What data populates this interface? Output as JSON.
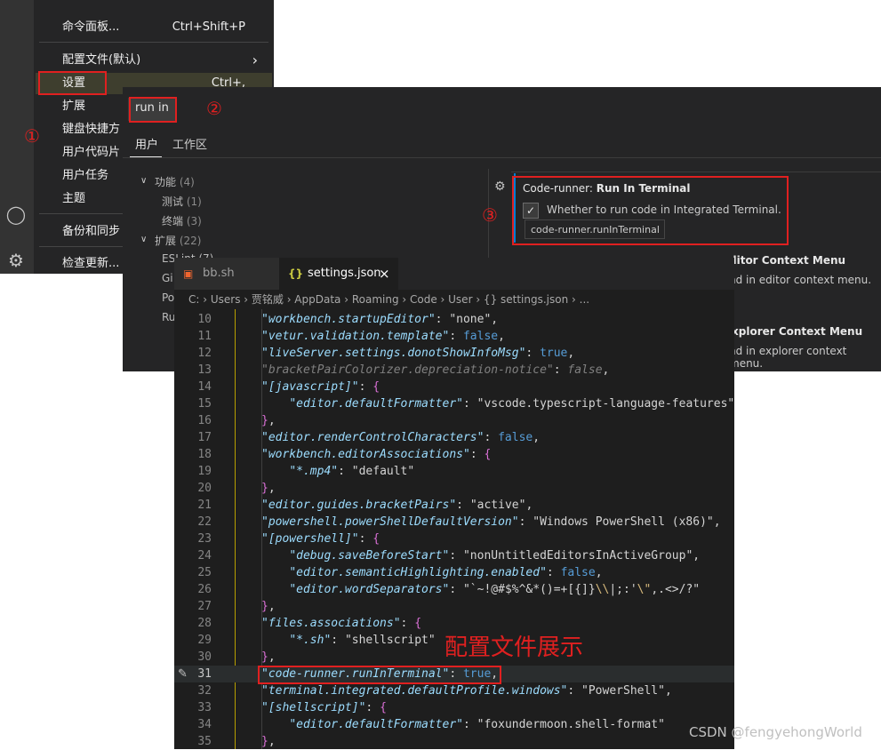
{
  "menu": {
    "items": [
      {
        "label": "命令面板...",
        "shortcut": "Ctrl+Shift+P"
      },
      {
        "label": "配置文件(默认)",
        "shortcut": "›"
      },
      {
        "label": "设置",
        "shortcut": "Ctrl+,"
      },
      {
        "label": "扩展",
        "shortcut": ""
      },
      {
        "label": "键盘快捷方",
        "shortcut": ""
      },
      {
        "label": "用户代码片",
        "shortcut": ""
      },
      {
        "label": "用户任务",
        "shortcut": ""
      },
      {
        "label": "主题",
        "shortcut": ""
      },
      {
        "label": "备份和同步",
        "shortcut": ""
      },
      {
        "label": "检查更新...",
        "shortcut": ""
      }
    ]
  },
  "settings": {
    "search_value": "run in",
    "tabs": [
      "用户",
      "工作区"
    ],
    "toc": [
      {
        "label": "功能",
        "count": "(4)"
      },
      {
        "label": "测试",
        "count": "(1)"
      },
      {
        "label": "终端",
        "count": "(3)"
      },
      {
        "label": "扩展",
        "count": "(22)"
      }
    ],
    "toc_truncated": [
      "ES",
      "Gi",
      "Po",
      "Ru"
    ],
    "toc_es_rest": "Lint (7)",
    "setting": {
      "prefix": "Code-runner: ",
      "name": "Run In Terminal",
      "description": "Whether to run code in Integrated Terminal.",
      "checked": "✓",
      "tooltip": "code-runner.runInTerminal"
    },
    "bg_settings": [
      {
        "title": "ditor Context Menu",
        "desc": "nd in editor context menu."
      },
      {
        "title": "xplorer Context Menu",
        "desc": "nd in explorer context menu."
      }
    ]
  },
  "editor": {
    "tabs": [
      {
        "label": "bb.sh",
        "icon": "terminal-file-icon"
      },
      {
        "label": "settings.json",
        "icon": "json-braces-icon",
        "close": "×"
      }
    ],
    "breadcrumb": "C: › Users › 贾铭威 › AppData › Roaming › Code › User › {} settings.json › ...",
    "line_numbers": [
      "10",
      "11",
      "12",
      "13",
      "14",
      "15",
      "16",
      "17",
      "18",
      "19",
      "20",
      "21",
      "22",
      "23",
      "24",
      "25",
      "26",
      "27",
      "28",
      "29",
      "30",
      "31",
      "32",
      "33",
      "34",
      "35"
    ]
  },
  "annotations": {
    "step1": "①",
    "step2": "②",
    "step3": "③",
    "caption": "配置文件展示",
    "watermark": "CSDN @fengyehongWorld"
  },
  "colors": {
    "annotation_red": "#e02020",
    "editor_bg": "#1e1e1e",
    "panel_bg": "#252526",
    "key_color": "#9cdcfe",
    "string_color": "#ce9178",
    "keyword_color": "#569cd6"
  }
}
